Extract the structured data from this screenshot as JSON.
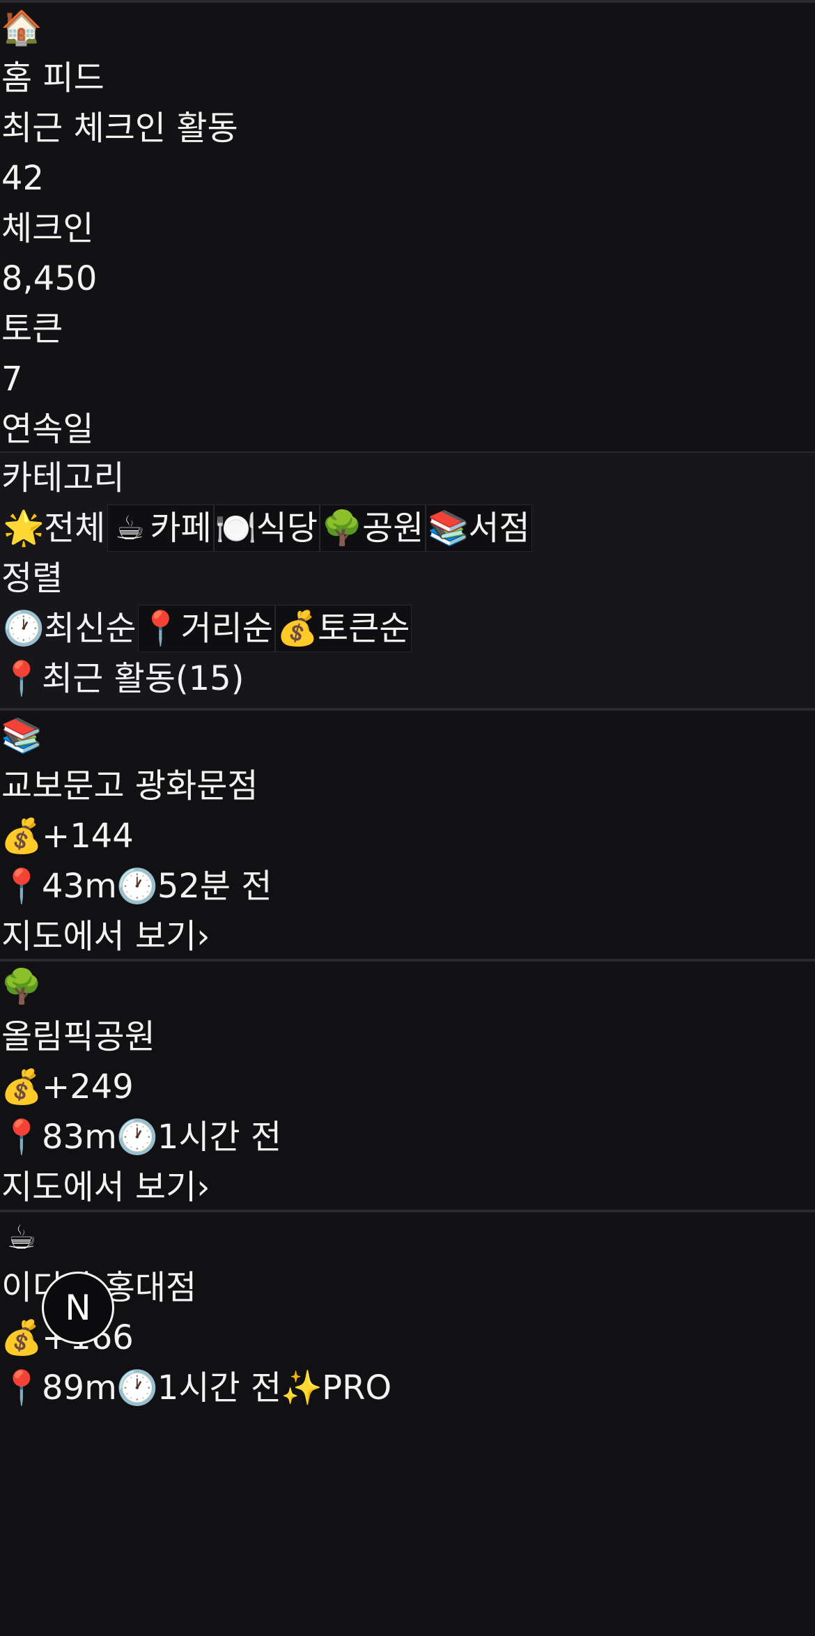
{
  "header": {
    "home_icon": "🏠",
    "title": "홈 피드",
    "subtitle": "최근 체크인 활동",
    "stats": [
      {
        "value": "42",
        "label": "체크인"
      },
      {
        "value": "8,450",
        "label": "토큰"
      },
      {
        "value": "7",
        "label": "연속일"
      }
    ]
  },
  "filters": {
    "category_title": "카테고리",
    "categories": [
      {
        "icon": "🌟",
        "label": "전체"
      },
      {
        "icon": "☕",
        "label": "카페"
      },
      {
        "icon": "🍽️",
        "label": "식당"
      },
      {
        "icon": "🌳",
        "label": "공원"
      },
      {
        "icon": "📚",
        "label": "서점"
      }
    ],
    "sort_title": "정렬",
    "sorts": [
      {
        "icon": "🕐",
        "label": "최신순"
      },
      {
        "icon": "📍",
        "label": "거리순"
      },
      {
        "icon": "💰",
        "label": "토큰순"
      }
    ],
    "recent": {
      "icon": "📍",
      "label": "최근 활동(15)"
    }
  },
  "feed": [
    {
      "category_icon": "📚",
      "title": "교보문고 광화문점",
      "token_icon": "💰",
      "token": "+144",
      "distance_icon": "📍",
      "distance": "43m",
      "time_icon": "🕐",
      "time": "52분 전",
      "link": "지도에서 보기›"
    },
    {
      "category_icon": "🌳",
      "title": "올림픽공원",
      "token_icon": "💰",
      "token": "+249",
      "distance_icon": "📍",
      "distance": "83m",
      "time_icon": "🕐",
      "time": "1시간 전",
      "link": "지도에서 보기›"
    },
    {
      "category_icon": "☕",
      "title": "이디야 홍대점",
      "token_icon": "💰",
      "token": "+166",
      "distance_icon": "📍",
      "distance": "89m",
      "time_icon": "🕐",
      "time": "1시간 전",
      "pro_icon": "✨",
      "pro": "PRO"
    }
  ],
  "badge": {
    "label": "N"
  }
}
